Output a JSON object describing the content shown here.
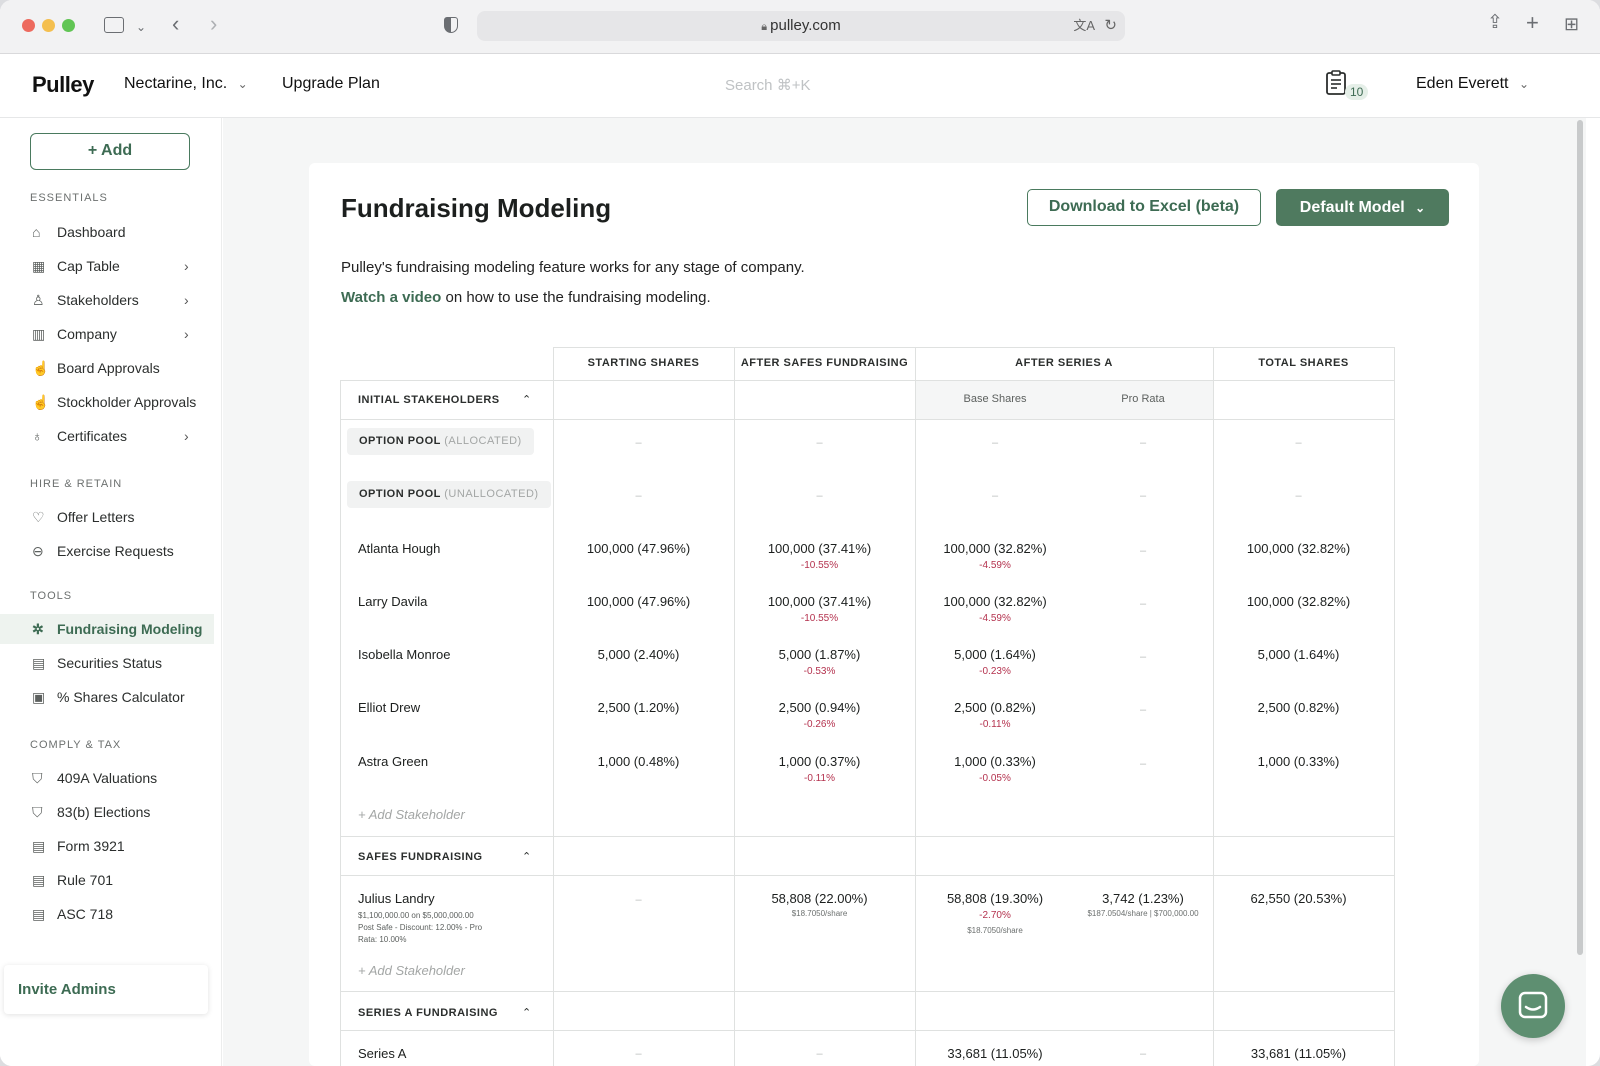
{
  "browser": {
    "url": "pulley.com"
  },
  "header": {
    "logo": "Pulley",
    "company": "Nectarine, Inc.",
    "upgrade": "Upgrade Plan",
    "search_placeholder": "Search ⌘+K",
    "notification_count": "10",
    "user": "Eden Everett"
  },
  "sidebar": {
    "add_label": "+ Add",
    "sections": [
      {
        "label": "ESSENTIALS",
        "items": [
          {
            "label": "Dashboard",
            "icon": "home-icon",
            "chevron": false
          },
          {
            "label": "Cap Table",
            "icon": "table-icon",
            "chevron": true
          },
          {
            "label": "Stakeholders",
            "icon": "users-icon",
            "chevron": true
          },
          {
            "label": "Company",
            "icon": "building-icon",
            "chevron": true
          },
          {
            "label": "Board Approvals",
            "icon": "thumbs-up-icon",
            "chevron": false
          },
          {
            "label": "Stockholder Approvals",
            "icon": "thumbs-up-icon",
            "chevron": false
          },
          {
            "label": "Certificates",
            "icon": "award-icon",
            "chevron": true
          }
        ]
      },
      {
        "label": "HIRE & RETAIN",
        "items": [
          {
            "label": "Offer Letters",
            "icon": "handshake-icon",
            "chevron": false
          },
          {
            "label": "Exercise Requests",
            "icon": "coins-icon",
            "chevron": false
          }
        ]
      },
      {
        "label": "TOOLS",
        "items": [
          {
            "label": "Fundraising Modeling",
            "icon": "sparkle-icon",
            "chevron": false,
            "active": true
          },
          {
            "label": "Securities Status",
            "icon": "document-icon",
            "chevron": false
          },
          {
            "label": "% Shares Calculator",
            "icon": "calculator-icon",
            "chevron": false
          }
        ]
      },
      {
        "label": "COMPLY & TAX",
        "items": [
          {
            "label": "409A Valuations",
            "icon": "shield-icon",
            "chevron": false
          },
          {
            "label": "83(b) Elections",
            "icon": "shield-icon",
            "chevron": false
          },
          {
            "label": "Form 3921",
            "icon": "form-icon",
            "chevron": false
          },
          {
            "label": "Rule 701",
            "icon": "form-icon",
            "chevron": false
          },
          {
            "label": "ASC 718",
            "icon": "form-icon",
            "chevron": false
          }
        ]
      }
    ],
    "invite": "Invite Admins"
  },
  "page": {
    "title": "Fundraising Modeling",
    "download_label": "Download to Excel (beta)",
    "model_label": "Default Model",
    "description": "Pulley's fundraising modeling feature works for any stage of company.",
    "video_link": "Watch a video",
    "video_suffix": " on how to use the fundraising modeling."
  },
  "table": {
    "columns": [
      "STARTING SHARES",
      "AFTER SAFES FUNDRAISING",
      "AFTER SERIES A",
      "TOTAL SHARES"
    ],
    "subcolumns": [
      "Base Shares",
      "Pro Rata"
    ],
    "dash": "–",
    "add_stakeholder": "+ Add Stakeholder",
    "groups": {
      "initial": "INITIAL STAKEHOLDERS",
      "safes": "SAFES FUNDRAISING",
      "series_a": "SERIES A FUNDRAISING"
    },
    "option_pools": [
      {
        "label": "OPTION POOL",
        "status": "(ALLOCATED)"
      },
      {
        "label": "OPTION POOL",
        "status": "(UNALLOCATED)"
      }
    ],
    "initial_rows": [
      {
        "name": "Atlanta Hough",
        "start": "100,000 (47.96%)",
        "safes": "100,000 (37.41%)",
        "safes_delta": "-10.55%",
        "base": "100,000 (32.82%)",
        "base_delta": "-4.59%",
        "total": "100,000 (32.82%)"
      },
      {
        "name": "Larry Davila",
        "start": "100,000 (47.96%)",
        "safes": "100,000 (37.41%)",
        "safes_delta": "-10.55%",
        "base": "100,000 (32.82%)",
        "base_delta": "-4.59%",
        "total": "100,000 (32.82%)"
      },
      {
        "name": "Isobella Monroe",
        "start": "5,000 (2.40%)",
        "safes": "5,000 (1.87%)",
        "safes_delta": "-0.53%",
        "base": "5,000 (1.64%)",
        "base_delta": "-0.23%",
        "total": "5,000 (1.64%)"
      },
      {
        "name": "Elliot Drew",
        "start": "2,500 (1.20%)",
        "safes": "2,500 (0.94%)",
        "safes_delta": "-0.26%",
        "base": "2,500 (0.82%)",
        "base_delta": "-0.11%",
        "total": "2,500 (0.82%)"
      },
      {
        "name": "Astra Green",
        "start": "1,000 (0.48%)",
        "safes": "1,000 (0.37%)",
        "safes_delta": "-0.11%",
        "base": "1,000 (0.33%)",
        "base_delta": "-0.05%",
        "total": "1,000 (0.33%)"
      }
    ],
    "safes_row": {
      "name": "Julius Landry",
      "terms1": "$1,100,000.00 on $5,000,000.00",
      "terms2": "Post Safe - Discount: 12.00% - Pro",
      "terms3": "Rata: 10.00%",
      "safes": "58,808 (22.00%)",
      "safes_price": "$18.7050/share",
      "base": "58,808 (19.30%)",
      "base_delta": "-2.70%",
      "base_price": "$18.7050/share",
      "prorata": "3,742 (1.23%)",
      "prorata_detail": "$187.0504/share | $700,000.00",
      "total": "62,550 (20.53%)"
    },
    "series_row": {
      "name": "Series A",
      "base": "33,681 (11.05%)",
      "total": "33,681 (11.05%)"
    }
  },
  "colors": {
    "brand": "#4f7a5f",
    "negative": "#b4324e"
  }
}
